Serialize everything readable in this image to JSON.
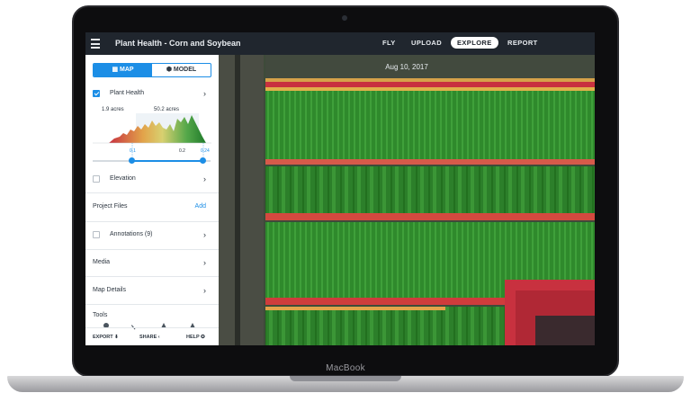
{
  "app": {
    "title": "Plant Health - Corn and Soybean",
    "nav": [
      "FLY",
      "UPLOAD",
      "EXPLORE",
      "REPORT"
    ],
    "active_nav": "EXPLORE"
  },
  "sidebar": {
    "toggle": {
      "map": "MAP",
      "model": "MODEL",
      "active": "map"
    },
    "plant_health": {
      "label": "Plant Health",
      "checked": true
    },
    "histogram": {
      "left_label": "1.9 acres",
      "right_label": "50.2 acres",
      "ticks": [
        "0.1",
        "0.2",
        "0.24"
      ],
      "range_low": 0.1,
      "range_high": 0.24
    },
    "elevation": {
      "label": "Elevation",
      "checked": false
    },
    "project_files": {
      "label": "Project Files",
      "action": "Add"
    },
    "annotations": {
      "label": "Annotations (9)",
      "checked": false
    },
    "media": {
      "label": "Media"
    },
    "map_details": {
      "label": "Map Details"
    },
    "tools": {
      "label": "Tools"
    },
    "footer": {
      "export": "EXPORT",
      "share": "SHARE",
      "help": "HELP"
    }
  },
  "map": {
    "date": "Aug 10, 2017"
  },
  "device": {
    "brand": "MacBook"
  },
  "colors": {
    "accent": "#1c8ee6",
    "topbar": "#20262e",
    "healthy": "#2f8a2c",
    "stressed": "#c8313f"
  }
}
